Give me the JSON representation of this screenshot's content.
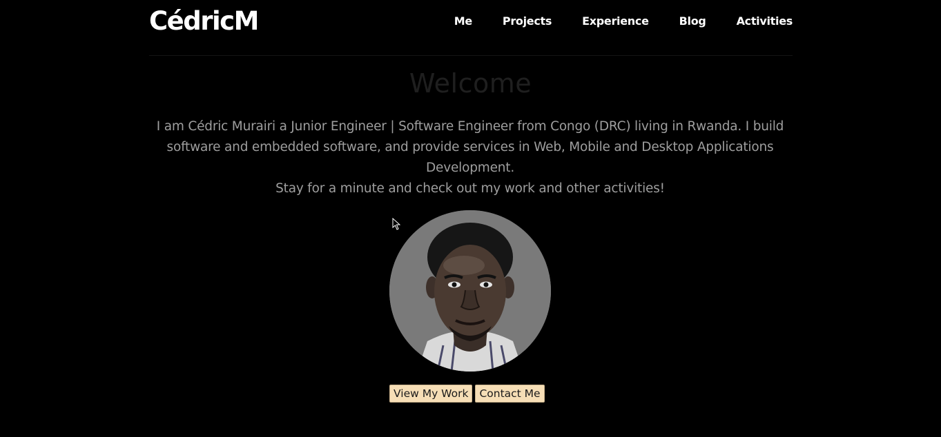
{
  "brand": {
    "name": "CédricM"
  },
  "nav": {
    "items": [
      {
        "label": "Me"
      },
      {
        "label": "Projects"
      },
      {
        "label": "Experience"
      },
      {
        "label": "Blog"
      },
      {
        "label": "Activities"
      }
    ]
  },
  "hero": {
    "title": "Welcome",
    "intro_line1": "I am Cédric Murairi a Junior Engineer | Software Engineer from Congo (DRC) living in Rwanda. I build software and embedded software, and provide services in Web, Mobile and Desktop Applications Development.",
    "intro_line2": "Stay for a minute and check out my work and other activities!",
    "avatar_icon": "profile-photo"
  },
  "actions": {
    "view_work": "View My Work",
    "contact": "Contact Me"
  },
  "colors": {
    "background": "#000000",
    "button_bg": "#f6deb6",
    "text_muted": "#9e9e9e",
    "title_dim": "#1f1f1f"
  }
}
